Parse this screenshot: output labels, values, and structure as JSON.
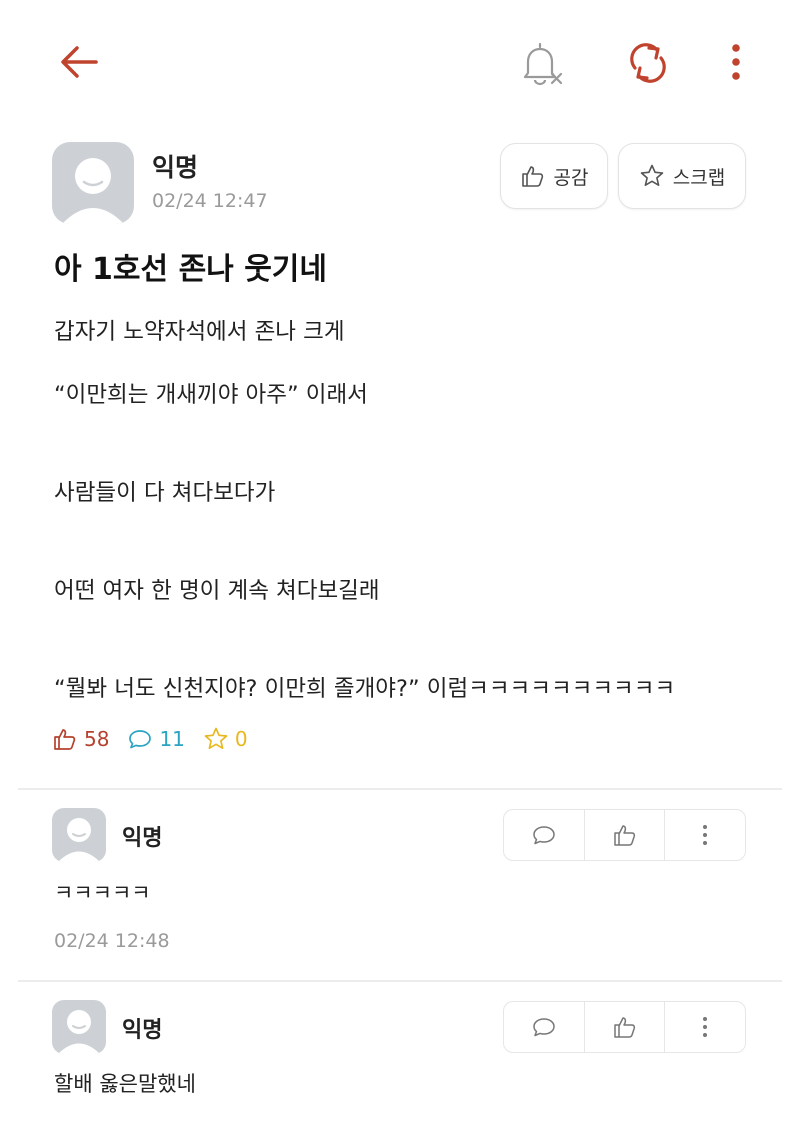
{
  "colors": {
    "accent": "#c0432e",
    "muted": "#9a9a9a",
    "comment_count": "#2ba3c2",
    "scrap_count": "#e8b820",
    "avatar_bg": "#cdd1d6"
  },
  "toolbar": {
    "icons": [
      "back-arrow-icon",
      "bell-off-icon",
      "refresh-icon",
      "more-vertical-icon"
    ]
  },
  "post": {
    "author": "익명",
    "time": "02/24 12:47",
    "like_label": "공감",
    "scrap_label": "스크랩",
    "title": "아 1호선 존나 웃기네",
    "lines": [
      "갑자기 노약자석에서 존나 크게",
      "“이만희는 개새끼야 아주” 이래서",
      "사람들이 다 쳐다보다가",
      "어떤 여자 한 명이 계속 쳐다보길래",
      "“뭘봐 너도 신천지야? 이만희 졸개야?” 이럼ㅋㅋㅋㅋㅋㅋㅋㅋㅋㅋ"
    ],
    "stats": {
      "likes": "58",
      "comments": "11",
      "scraps": "0"
    }
  },
  "comments": [
    {
      "author": "익명",
      "text": "ㅋㅋㅋㅋㅋ",
      "time": "02/24 12:48"
    },
    {
      "author": "익명",
      "text": "할배 옳은말했네"
    }
  ]
}
